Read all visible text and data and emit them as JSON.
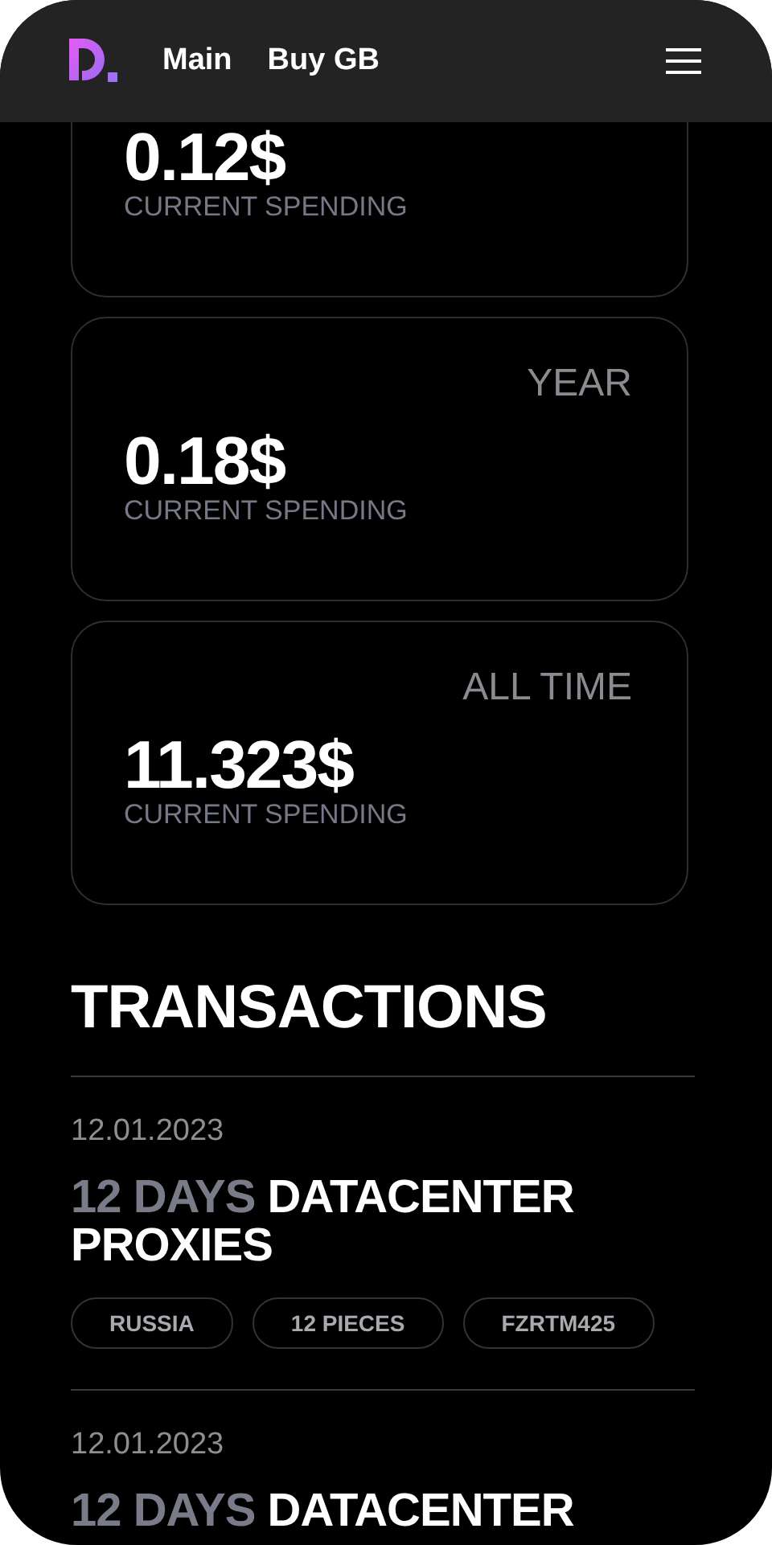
{
  "header": {
    "nav": [
      {
        "label": "Main"
      },
      {
        "label": "Buy GB"
      }
    ]
  },
  "spending_cards": [
    {
      "amount": "0.12$",
      "caption": "CURRENT SPENDING"
    },
    {
      "period": "YEAR",
      "amount": "0.18$",
      "caption": "CURRENT SPENDING"
    },
    {
      "period": "ALL TIME",
      "amount": "11.323$",
      "caption": "CURRENT SPENDING"
    }
  ],
  "transactions": {
    "title": "TRANSACTIONS",
    "items": [
      {
        "date": "12.01.2023",
        "duration": "12 DAYS",
        "product": "DATACENTER PROXIES",
        "tags": [
          "RUSSIA",
          "12 PIECES",
          "FZRTM425"
        ]
      },
      {
        "date": "12.01.2023",
        "duration": "12 DAYS",
        "product": "DATACENTER"
      }
    ]
  }
}
